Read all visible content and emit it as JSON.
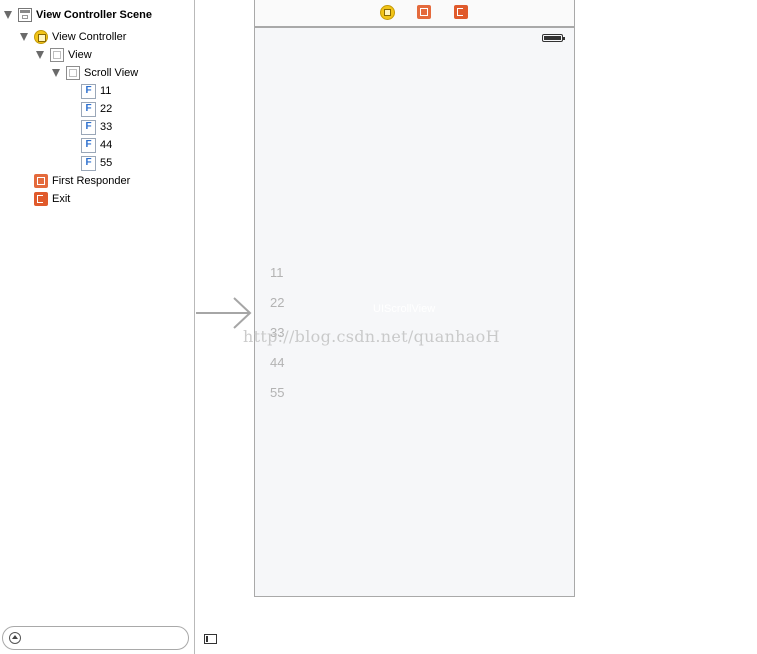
{
  "outline": {
    "scene": "View Controller Scene",
    "view_controller": "View Controller",
    "view": "View",
    "scroll_view": "Scroll View",
    "fields": [
      "11",
      "22",
      "33",
      "44",
      "55"
    ],
    "first_responder": "First Responder",
    "exit": "Exit",
    "field_icon_glyph": "F"
  },
  "canvas": {
    "scroll_view_label": "UIScrollView",
    "field_values": [
      "11",
      "22",
      "33",
      "44",
      "55"
    ],
    "watermark": "http://blog.csdn.net/quanhaoH"
  },
  "icons": {
    "scene": "scene-icon",
    "view_controller": "view-controller-icon",
    "view": "view-icon",
    "text_field": "text-field-icon",
    "first_responder": "first-responder-icon",
    "exit": "exit-icon",
    "filter": "filter-icon",
    "battery": "battery-icon",
    "entry_arrow": "arrow-right-icon",
    "outline_toggle": "sidebar-toggle-icon"
  },
  "colors": {
    "view_controller_yellow": "#f2c418",
    "first_responder_orange": "#e46a3c",
    "exit_orange": "#e05a2b",
    "field_blue": "#2c6fcf",
    "device_background": "#f6f7f9"
  }
}
